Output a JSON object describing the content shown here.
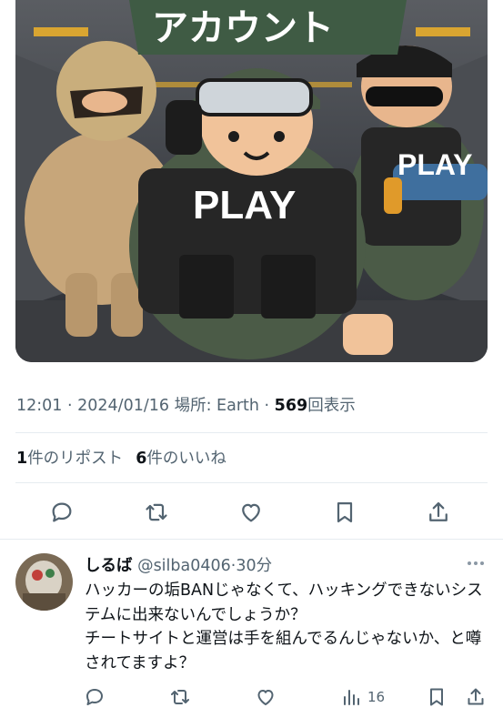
{
  "media": {
    "banner_text": "アカウント",
    "vest_text_center": "PLAY",
    "vest_text_right": "PLAY"
  },
  "tweet_meta": {
    "time": "12:01",
    "sep1": " · ",
    "date": "2024/01/16",
    "location_label": " 場所: Earth",
    "sep2": " · ",
    "views_count": "569",
    "views_label": "回表示"
  },
  "stats": {
    "reposts_count": "1",
    "reposts_label": "件のリポスト",
    "likes_count": "6",
    "likes_label": "件のいいね"
  },
  "actions": [
    "reply-icon",
    "repost-icon",
    "like-icon",
    "bookmark-icon",
    "share-icon"
  ],
  "reply": {
    "display_name": "しるば",
    "handle": " @silba0406",
    "sep": "·",
    "time": "30分",
    "text": "ハッカーの垢BANじゃなくて、ハッキングできないシステムに出来ないんでしょうか？\nチートサイトと運営は手を組んでるんじゃないか、と噂されてますよ？",
    "views": "16"
  },
  "colors": {
    "secondary_text": "#536471",
    "primary_text": "#0f1419",
    "divider": "#e6ecf0",
    "banner_green": "#3f5b44",
    "vest_black": "#262626"
  }
}
